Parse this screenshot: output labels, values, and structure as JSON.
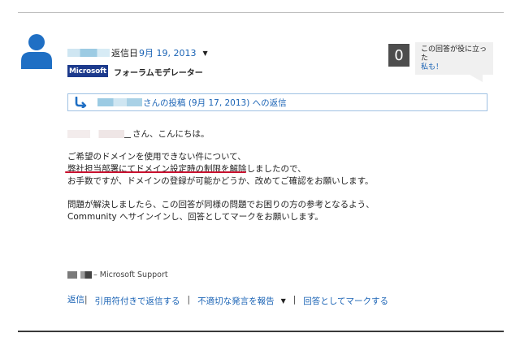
{
  "post": {
    "author_label": "返信日",
    "date": "9月 19, 2013",
    "badge": "Microsoft",
    "role": "フォーラムモデレーター",
    "vote_count": "0",
    "helpful_line1": "この回答が役に立った",
    "helpful_line2": "私も！"
  },
  "reply_ref": {
    "text": "さんの投稿 (9月 17, 2013) への返信"
  },
  "body": {
    "greeting": "さん、こんにちは。",
    "p1_line1": "ご希望のドメインを使用できない件について、",
    "p1_line2": "弊社担当部署にてドメイン設定時の制限を解除しましたので、",
    "p1_line3": "お手数ですが、ドメインの登録が可能かどうか、改めてご確認をお願いします。",
    "p2_line1": "問題が解決しましたら、この回答が同様の問題でお困りの方の参考となるよう、",
    "p2_line2": "Community へサインインし、回答としてマークをお願いします。"
  },
  "signature": "– Microsoft Support",
  "actions": {
    "reply": "返信",
    "quote_reply": "引用符付きで返信する",
    "report": "不適切な発言を報告",
    "mark_answer": "回答としてマークする"
  },
  "colors": {
    "link": "#1a63b5",
    "badge_bg": "#1c3a8c",
    "vote_bg": "#4d4d4d",
    "highlight": "#c8102e"
  },
  "icons": {
    "avatar": "person-icon",
    "reply_arrow": "reply-arrow-icon",
    "dropdown": "caret-down-icon"
  }
}
